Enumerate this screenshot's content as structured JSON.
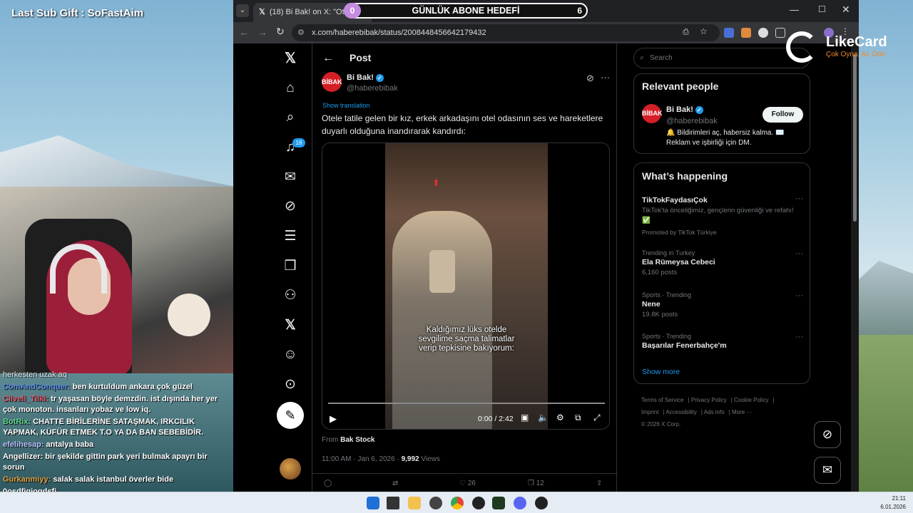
{
  "stream": {
    "gift_text": "Last Sub Gift : SoFastAim",
    "logo_name": "LikeCard",
    "logo_tagline": "Çok Oyna, Az Öde",
    "goal_count": "0",
    "goal_label": "GÜNLÜK ABONE HEDEFİ",
    "goal_target": "6"
  },
  "chat": [
    {
      "user": "",
      "text": "herkesten uzak aq"
    },
    {
      "user": "ComAndConquer:",
      "text": "ben kurtuldum ankara çok güzel"
    },
    {
      "user": "Cilveli_Tilki:",
      "text": "tr yaşasan böyle demzdin. ist dışında her yer çok monoton. insanları yobaz ve low iq."
    },
    {
      "user": "BotRix:",
      "text": "CHATTE BİRİLERİNE SATAŞMAK, IRKCILIK YAPMAK, KÜFÜR ETMEK T.O YA DA BAN SEBEBİDİR."
    },
    {
      "user": "efelihesap:",
      "text": "antalya baba"
    },
    {
      "user": "Angellizer:",
      "text": "bir şekilde gittin park yeri bulmak apayrı bir sorun"
    },
    {
      "user": "Gurkanmiyy:",
      "text": "salak salak istanbul överler bide"
    },
    {
      "user": "",
      "text": "0osdfjgiogdsfj"
    }
  ],
  "browser": {
    "tab_title": "(18) Bi Bak! on X: \"Otele tatile",
    "url": "x.com/haberebibak/status/2008448456642179432"
  },
  "icons": {
    "x_logo": "x-logo-icon",
    "home": "home-icon",
    "explore": "search-icon",
    "notifications": "bell-icon",
    "messages": "mail-icon",
    "grok": "grok-icon",
    "lists": "list-icon",
    "bookmarks": "bookmark-icon",
    "communities": "communities-icon",
    "premium": "x-premium-icon",
    "profile": "person-icon",
    "more": "more-circle-icon",
    "compose": "compose-icon"
  },
  "nav": {
    "notif_badge": "18"
  },
  "post": {
    "header": "Post",
    "author_name": "Bi Bak!",
    "author_handle": "@haberebibak",
    "avatar_text": "BİBAK",
    "show_translation": "Show translation",
    "text": "Otele tatile gelen bir kız, erkek arkadaşını otel odasının ses ve hareketlere duyarlı olduğuna inandırarak kandırdı:",
    "video_caption": "Kaldığımız lüks otelde\nsevgilime saçma talimatlar\nverip tepkisine bakıyorum:",
    "video_time": "0:00 / 2:42",
    "video_progress": 0,
    "from_label": "From",
    "from_source": "Bak Stock",
    "timestamp": "11:00 AM · Jan 6, 2026 ·",
    "views_count": "9,992",
    "views_label": "Views",
    "likes": "26",
    "bookmarks": "12"
  },
  "sidebar": {
    "search_placeholder": "Search",
    "relevant_title": "Relevant people",
    "rel_name": "Bi Bak!",
    "rel_handle": "@haberebibak",
    "follow_label": "Follow",
    "rel_bio": "🔔 Bildirimleri aç, habersiz kalma. ✉️ Reklam ve işbirliği için DM.",
    "happening_title": "What’s happening",
    "trends": [
      {
        "ctx": "",
        "topic": "TikTokFaydasıÇok",
        "sub": "TikTok'ta önceliğimiz, gençlerin güvenliği ve refahı! ✅",
        "extra": "Promoted by TikTok Türkiye"
      },
      {
        "ctx": "Trending in Turkey",
        "topic": "Ela Rümeysa Cebeci",
        "sub": "6,160 posts",
        "extra": ""
      },
      {
        "ctx": "Sports · Trending",
        "topic": "Nene",
        "sub": "19.8K posts",
        "extra": ""
      },
      {
        "ctx": "Sports · Trending",
        "topic": "Başarılar Fenerbahçe'm",
        "sub": "",
        "extra": ""
      }
    ],
    "show_more": "Show more",
    "footer": [
      "Terms of Service",
      "Privacy Policy",
      "Cookie Policy",
      "Imprint",
      "Accessibility",
      "Ads info",
      "More ···",
      "© 2026 X Corp."
    ]
  },
  "taskbar": {
    "time": "21:11",
    "date": "6.01.2026"
  }
}
